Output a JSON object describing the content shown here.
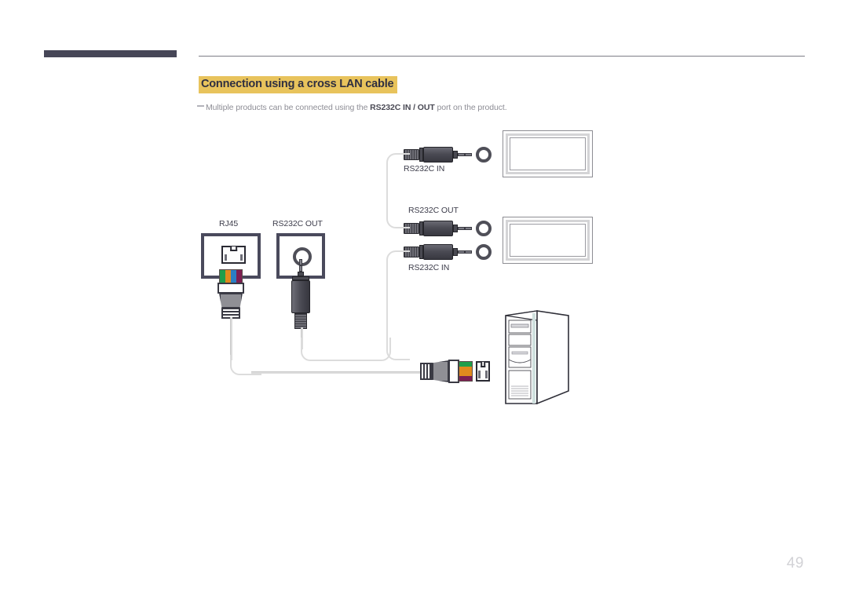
{
  "page": {
    "number": "49",
    "accent_color": "#e8c35c",
    "rule_color": "#7e7e86",
    "bar_color": "#464657"
  },
  "header": {
    "title": "Connection using a cross LAN cable",
    "note_prefix": "Multiple products can be connected using the ",
    "note_bold": "RS232C IN / OUT",
    "note_suffix": " port on the product."
  },
  "diagram": {
    "labels": {
      "rj45": "RJ45",
      "rs232c_out_port": "RS232C OUT",
      "rs232c_in_top": "RS232C IN",
      "rs232c_out_mid": "RS232C OUT",
      "rs232c_in_bottom": "RS232C IN"
    },
    "devices": {
      "monitor_top": "display-1",
      "monitor_bottom": "display-2",
      "pc": "desktop-computer"
    },
    "wire_colors": [
      "#1f9e4b",
      "#e08a1e",
      "#2a7fc4",
      "#7d1f52"
    ],
    "cable_color": "#dcdcdc",
    "connector_body_color": "#4b4b54",
    "port_border_color": "#4a4a5c"
  }
}
